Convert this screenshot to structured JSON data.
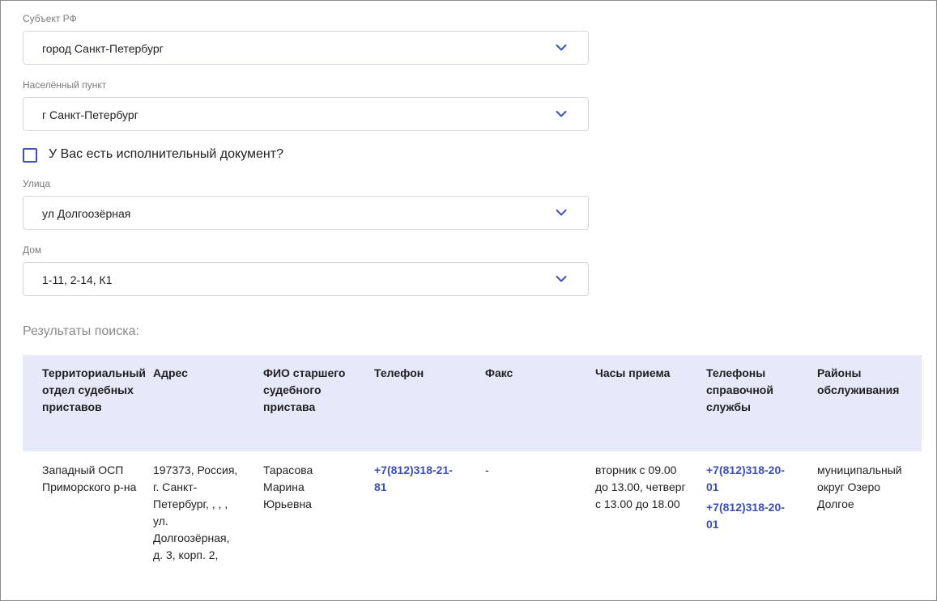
{
  "form": {
    "subject": {
      "label": "Субъект РФ",
      "value": "город Санкт-Петербург"
    },
    "locality": {
      "label": "Населённый пункт",
      "value": "г Санкт-Петербург"
    },
    "has_document": {
      "label": "У Вас есть исполнительный документ?",
      "checked": false
    },
    "street": {
      "label": "Улица",
      "value": "ул Долгоозёрная"
    },
    "house": {
      "label": "Дом",
      "value": "1-11, 2-14, К1"
    }
  },
  "results": {
    "title": "Результаты поиска:",
    "columns": [
      "Территориальный отдел судебных приставов",
      "Адрес",
      "ФИО старшего судебного пристава",
      "Телефон",
      "Факс",
      "Часы приема",
      "Телефоны справочной службы",
      "Районы обслуживания"
    ],
    "rows": [
      {
        "department": "Западный ОСП Приморского р-на",
        "address": "197373, Россия, г. Санкт-Петербург, , , , ул. Долгоозёрная, д. 3, корп. 2,",
        "chief": "Тарасова Марина Юрьевна",
        "phone": "+7(812)318-21-81",
        "fax": "-",
        "hours": "вторник с 09.00 до 13.00, четверг с 13.00 до 18.00",
        "help_phones": [
          "+7(812)318-20-01",
          "+7(812)318-20-01"
        ],
        "districts": "муниципальный округ Озеро Долгое"
      }
    ]
  },
  "colors": {
    "accent": "#3f51b5",
    "header_bg": "#e5e9fa",
    "link": "#3b4fb0"
  },
  "icons": {
    "select_arrow": "chevron-down-icon"
  }
}
